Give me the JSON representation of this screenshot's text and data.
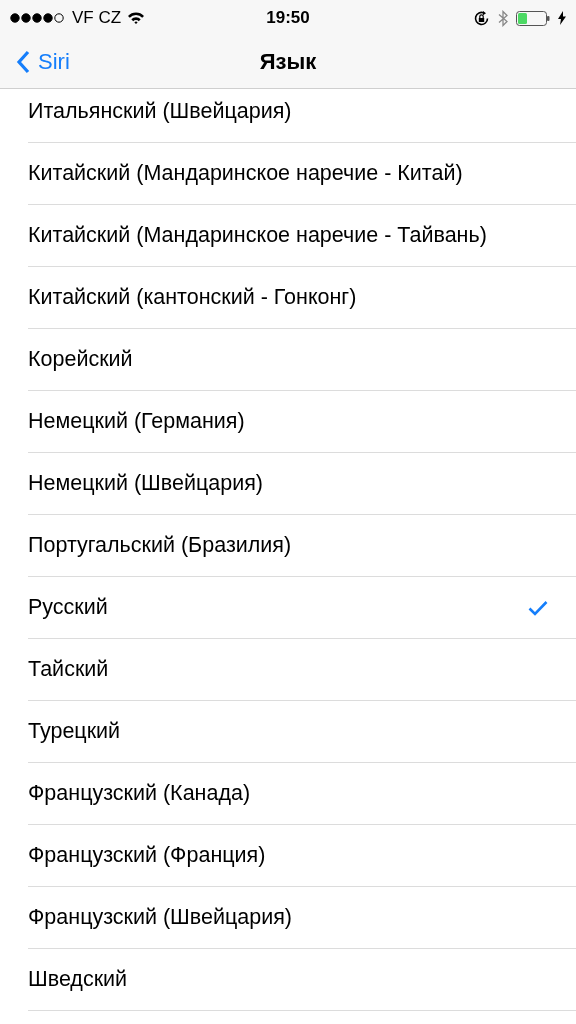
{
  "status_bar": {
    "carrier": "VF CZ",
    "time": "19:50"
  },
  "nav": {
    "back": "Siri",
    "title": "Язык"
  },
  "languages": [
    {
      "label": "Итальянский (Швейцария)",
      "selected": false
    },
    {
      "label": "Китайский (Мандаринское наречие - Китай)",
      "selected": false
    },
    {
      "label": "Китайский (Мандаринское наречие - Тайвань)",
      "selected": false
    },
    {
      "label": "Китайский (кантонский - Гонконг)",
      "selected": false
    },
    {
      "label": "Корейский",
      "selected": false
    },
    {
      "label": "Немецкий (Германия)",
      "selected": false
    },
    {
      "label": "Немецкий (Швейцария)",
      "selected": false
    },
    {
      "label": "Португальский (Бразилия)",
      "selected": false
    },
    {
      "label": "Русский",
      "selected": true
    },
    {
      "label": "Тайский",
      "selected": false
    },
    {
      "label": "Турецкий",
      "selected": false
    },
    {
      "label": "Французский (Канада)",
      "selected": false
    },
    {
      "label": "Французский (Франция)",
      "selected": false
    },
    {
      "label": "Французский (Швейцария)",
      "selected": false
    },
    {
      "label": "Шведский",
      "selected": false
    }
  ]
}
